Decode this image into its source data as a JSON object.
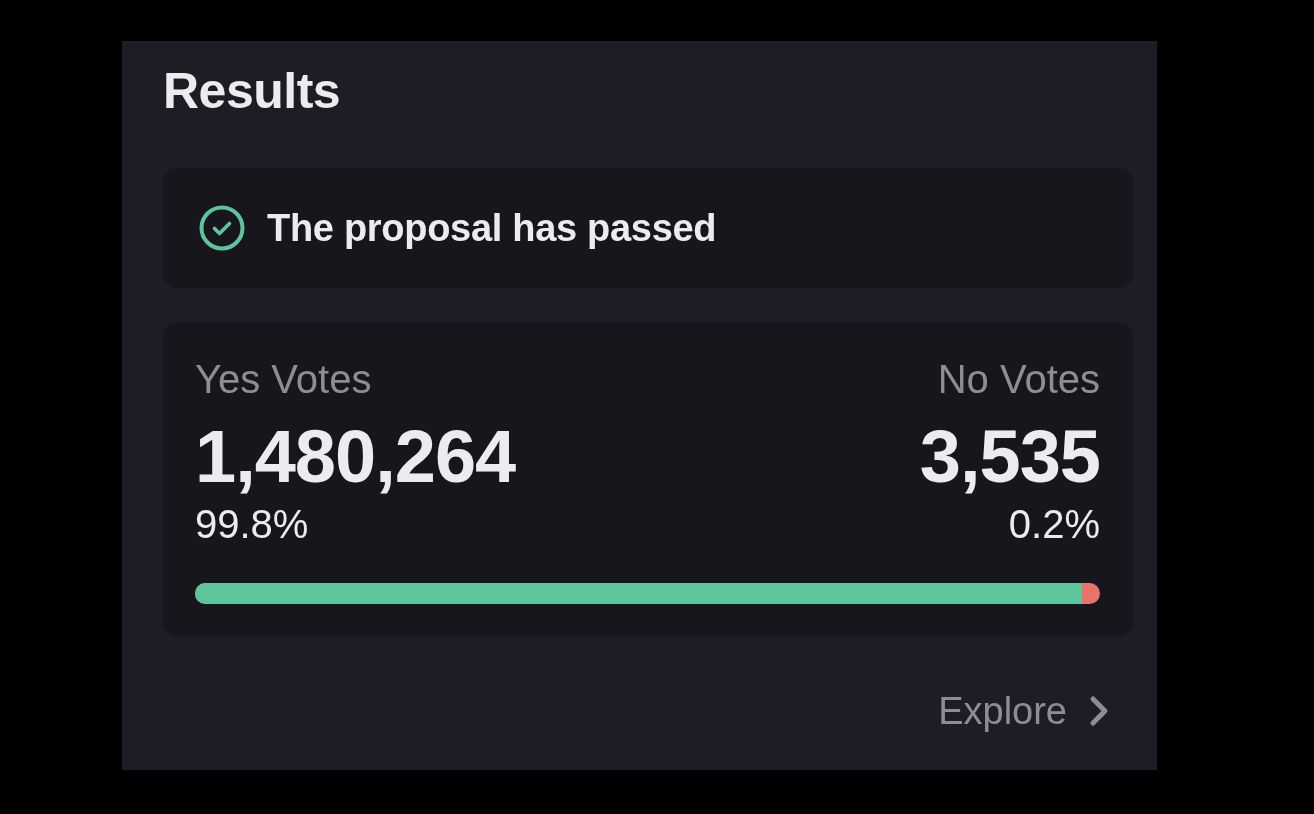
{
  "panel": {
    "title": "Results"
  },
  "status": {
    "kind": "passed",
    "text": "The proposal has passed"
  },
  "votes": {
    "options": [
      {
        "label": "Yes Votes",
        "count": "1,480,264",
        "percent": "99.8%",
        "color": "#5ec49b"
      },
      {
        "label": "No Votes",
        "count": "3,535",
        "percent": "0.2%",
        "color": "#e8746e"
      }
    ],
    "bar": {
      "level": 0.98
    }
  },
  "explore_link": {
    "label": "Explore"
  }
}
